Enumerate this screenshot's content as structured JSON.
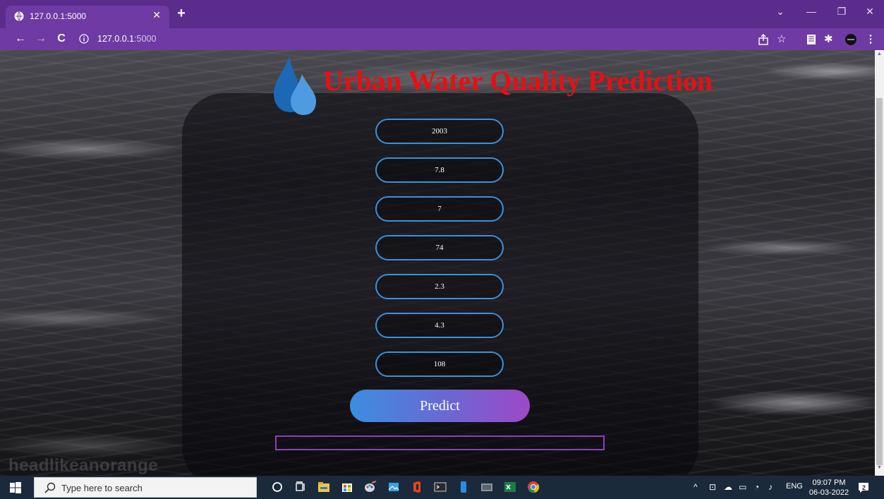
{
  "browser": {
    "tab_title": "127.0.0.1:5000",
    "url_host": "127.0.0.1",
    "url_port": ":5000",
    "accent_color": "#6f3aa3",
    "window_controls": [
      "minimize-icon",
      "restore-icon",
      "close-icon"
    ]
  },
  "page": {
    "title": "Urban Water Quality Prediction",
    "title_color": "#e80f12",
    "watermark": "headlikeanorange",
    "fields": [
      {
        "value": "2003"
      },
      {
        "value": "7.8"
      },
      {
        "value": "7"
      },
      {
        "value": "74"
      },
      {
        "value": "2.3"
      },
      {
        "value": "4.3"
      },
      {
        "value": "108"
      }
    ],
    "predict_label": "Predict",
    "result_text": ""
  },
  "taskbar": {
    "search_placeholder": "Type here to search",
    "language": "ENG",
    "time": "09:07 PM",
    "date": "06-03-2022",
    "notification_count": "2",
    "apps": [
      "cortana-icon",
      "task-view-icon",
      "file-explorer-icon",
      "store-icon",
      "paint-icon",
      "photos-icon",
      "office-icon",
      "terminal-icon",
      "phone-icon",
      "desktop-app-icon",
      "excel-icon",
      "chrome-icon"
    ]
  }
}
